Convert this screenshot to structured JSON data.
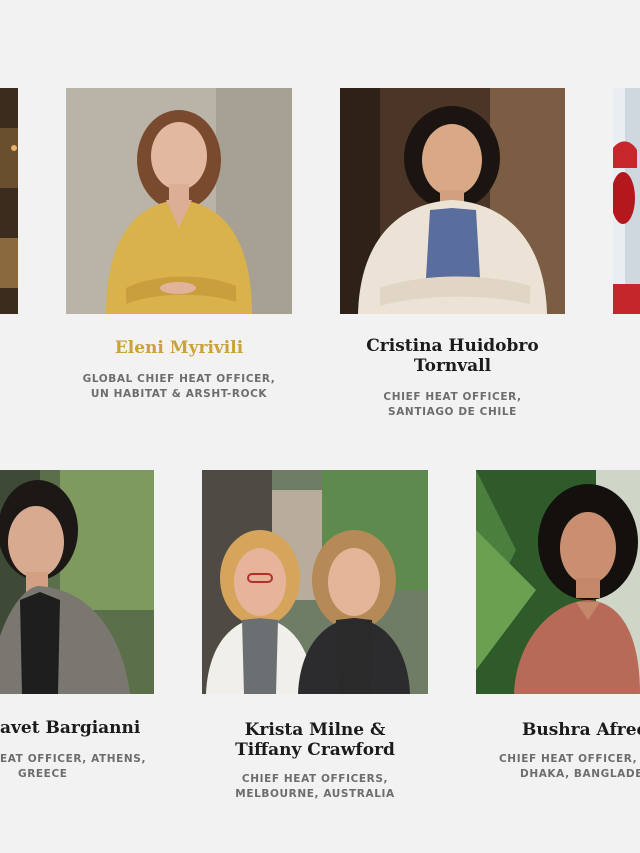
{
  "people": [
    {
      "name_lines": [
        "",
        ""
      ],
      "role_lines": [
        "",
        ""
      ]
    },
    {
      "name_lines": [
        "Eleni Myrivili",
        ""
      ],
      "role_lines": [
        "GLOBAL CHIEF HEAT OFFICER,",
        "UN HABITAT & ARSHT-ROCK"
      ],
      "highlight": true
    },
    {
      "name_lines": [
        "Cristina Huidobro",
        "Tornvall"
      ],
      "role_lines": [
        "CHIEF HEAT OFFICER,",
        "SANTIAGO DE CHILE"
      ]
    },
    {
      "name_lines": [
        "",
        ""
      ],
      "role_lines": [
        "",
        ""
      ]
    },
    {
      "name_lines": [
        "avet Bargianni",
        ""
      ],
      "role_lines": [
        "EAT OFFICER, ATHENS,",
        "GREECE"
      ]
    },
    {
      "name_lines": [
        "Krista Milne &",
        "Tiffany Crawford"
      ],
      "role_lines": [
        "CHIEF HEAT OFFICERS,",
        "MELBOURNE, AUSTRALIA"
      ]
    },
    {
      "name_lines": [
        "Bushra Afree",
        ""
      ],
      "role_lines": [
        "CHIEF HEAT OFFICER, N",
        "DHAKA, BANGLADE"
      ]
    }
  ],
  "colors": {
    "background": "#f2f2f2",
    "name": "#1b1b1b",
    "name_highlight": "#c9a23a",
    "role": "#6d6d6d"
  }
}
